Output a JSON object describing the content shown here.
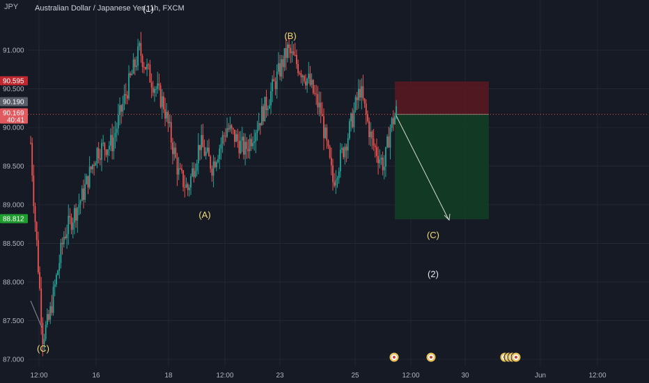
{
  "header": {
    "symbol_code": "JPY",
    "title": "Australian Dollar / Japanese Yen, 1h, FXCM"
  },
  "price_tags": {
    "stop": "90.595",
    "last_gray": "90.190",
    "current": "90.169",
    "countdown": "40:41",
    "target": "88.812"
  },
  "colors": {
    "background": "#161a25",
    "up": "#26a69a",
    "down": "#ef5350",
    "stop_zone": "#5b1a22",
    "target_zone": "#123d25",
    "wave_label": "#f2dc7a",
    "wave_label_white": "#e6e6e6",
    "arrow": "#d9d9d9"
  },
  "chart_data": {
    "type": "candlestick",
    "symbol": "AUD/JPY",
    "timeframe": "1h",
    "y_axis": {
      "ticks": [
        "91.000",
        "90.500",
        "90.000",
        "89.500",
        "89.000",
        "88.500",
        "88.000",
        "87.500",
        "87.000"
      ],
      "ylim": [
        86.95,
        91.45
      ]
    },
    "x_axis": {
      "ticks": [
        "12:00",
        "16",
        "18",
        "12:00",
        "23",
        "25",
        "12:00",
        "30",
        "Jun",
        "12:00"
      ]
    },
    "price_path": [
      [
        0,
        89.8
      ],
      [
        2,
        89.1
      ],
      [
        8,
        87.3
      ],
      [
        12,
        87.5
      ],
      [
        22,
        88.6
      ],
      [
        34,
        89.1
      ],
      [
        44,
        89.7
      ],
      [
        54,
        89.8
      ],
      [
        64,
        90.5
      ],
      [
        72,
        91.0
      ],
      [
        78,
        90.7
      ],
      [
        88,
        90.3
      ],
      [
        98,
        89.4
      ],
      [
        104,
        89.2
      ],
      [
        112,
        89.8
      ],
      [
        120,
        89.5
      ],
      [
        130,
        90.0
      ],
      [
        142,
        89.7
      ],
      [
        156,
        90.3
      ],
      [
        170,
        91.0
      ],
      [
        184,
        90.6
      ],
      [
        192,
        90.2
      ],
      [
        200,
        89.3
      ],
      [
        210,
        89.9
      ],
      [
        218,
        90.5
      ],
      [
        226,
        89.8
      ],
      [
        234,
        89.5
      ],
      [
        238,
        90.0
      ],
      [
        242,
        90.2
      ]
    ],
    "position": {
      "side": "short",
      "entry": 90.169,
      "stop": 90.595,
      "target": 88.812
    },
    "wave_labels": [
      {
        "text": "(C)",
        "price": 86.9
      },
      {
        "text": "(1)",
        "price": 91.0
      },
      {
        "text": "(A)",
        "price": 88.95
      },
      {
        "text": "(B)",
        "price": 91.3
      },
      {
        "text": "(C)",
        "price": 88.58
      },
      {
        "text": "(2)",
        "price": 88.1
      }
    ],
    "events": 6
  }
}
